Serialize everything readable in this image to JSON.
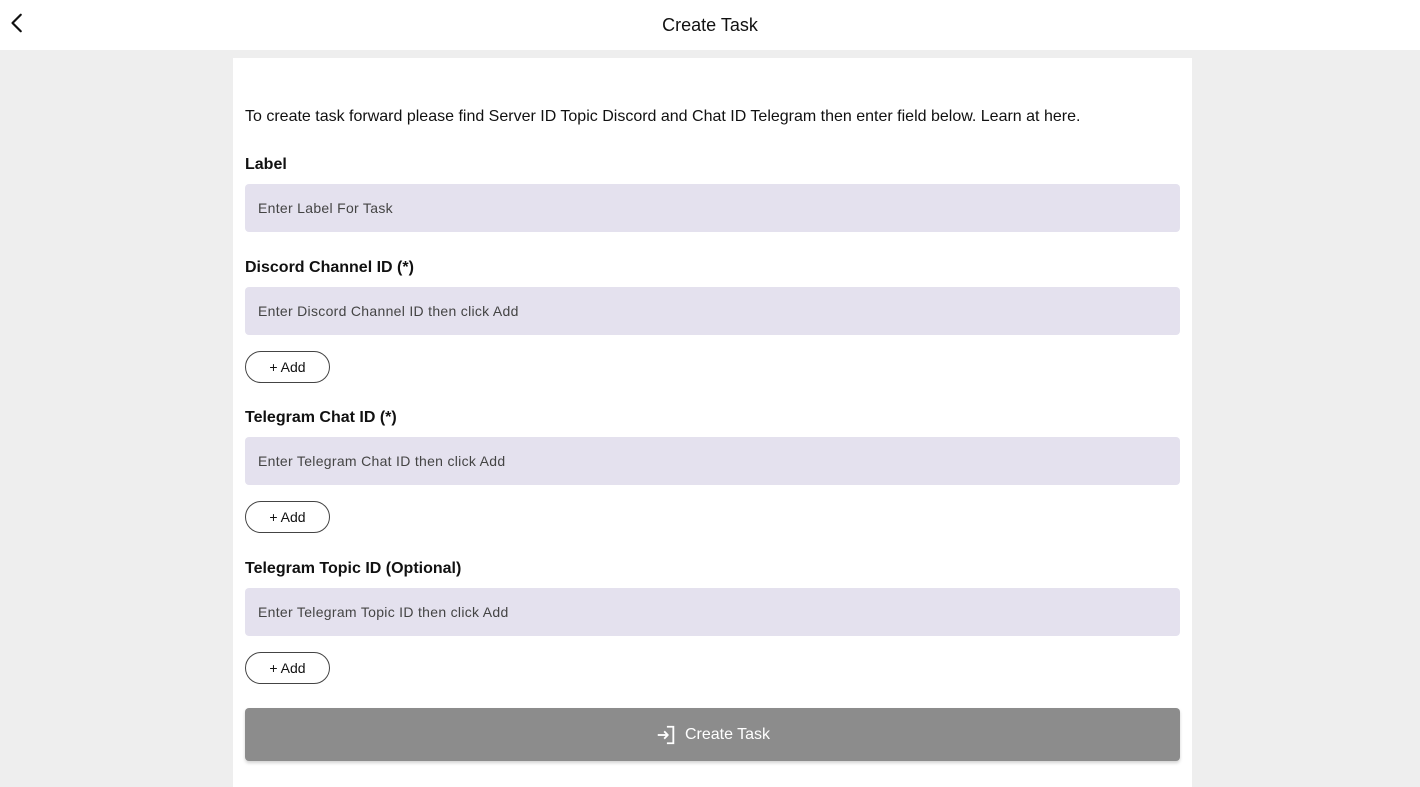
{
  "header": {
    "title": "Create Task",
    "back_icon": "chevron-left-icon"
  },
  "form": {
    "intro": "To create task forward please find Server ID Topic Discord and Chat ID Telegram then enter field below. Learn at here.",
    "label_field": {
      "label": "Label",
      "placeholder": "Enter Label For Task"
    },
    "discord_field": {
      "label": "Discord Channel ID (*)",
      "placeholder": "Enter Discord Channel ID then click Add",
      "add_label": "+ Add"
    },
    "telegram_chat_field": {
      "label": "Telegram Chat ID (*)",
      "placeholder": "Enter Telegram Chat ID then click Add",
      "add_label": "+ Add"
    },
    "telegram_topic_field": {
      "label": "Telegram Topic ID (Optional)",
      "placeholder": "Enter Telegram Topic ID then click Add",
      "add_label": "+ Add"
    },
    "submit": {
      "label": "Create Task",
      "icon": "login-icon"
    }
  },
  "colors": {
    "input_background": "#e4e1ee",
    "submit_background": "#8c8c8c",
    "page_background": "#eeeeee"
  }
}
